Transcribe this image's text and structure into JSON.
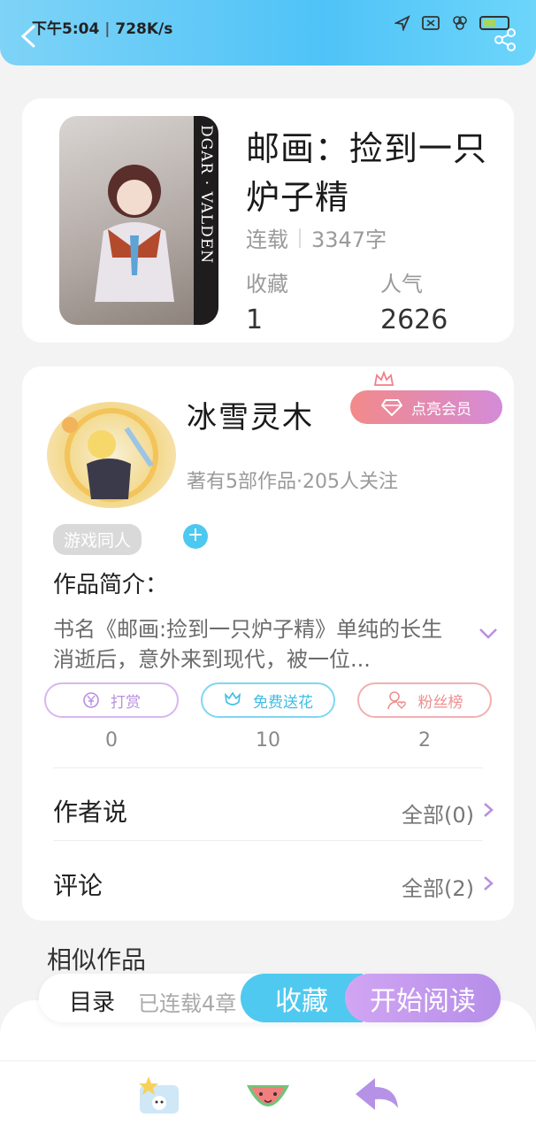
{
  "status": {
    "time": "下午5:04",
    "speed": "728K/s"
  },
  "book": {
    "cover_text": "DGAR · VALDEN",
    "title": "邮画：捡到一只炉子精",
    "status": "连载",
    "word_count": "3347字",
    "collect_label": "收藏",
    "collect_value": "1",
    "popularity_label": "人气",
    "popularity_value": "2626"
  },
  "author": {
    "name": "冰雪灵木",
    "vip_label": "点亮会员",
    "stats": "著有5部作品·205人关注",
    "tag": "游戏同人",
    "add_tag": "+"
  },
  "intro": {
    "label": "作品简介：",
    "text": "书名《邮画:捡到一只炉子精》单纯的长生消逝后，意外来到现代，被一位..."
  },
  "actions": [
    {
      "label": "打赏",
      "count": "0",
      "color": "#c9a3e6"
    },
    {
      "label": "免费送花",
      "count": "10",
      "color": "#4dc8f0"
    },
    {
      "label": "粉丝榜",
      "count": "2",
      "color": "#f0a0a0"
    }
  ],
  "rows": [
    {
      "label": "作者说",
      "value": "全部(0)"
    },
    {
      "label": "评论",
      "value": "全部(2)"
    }
  ],
  "similar": {
    "title": "相似作品"
  },
  "bottom": {
    "toc_label": "目录",
    "toc_count": "已连载4章",
    "collect_button": "收藏",
    "read_button": "开始阅读"
  },
  "nav": {
    "icons": [
      "star-book-icon",
      "watermelon-icon",
      "back-arrow-icon"
    ]
  },
  "colors": {
    "accent_blue": "#4fc9ef",
    "accent_purple": "#c9a3e6",
    "vip_pink": "#f28a8a"
  }
}
